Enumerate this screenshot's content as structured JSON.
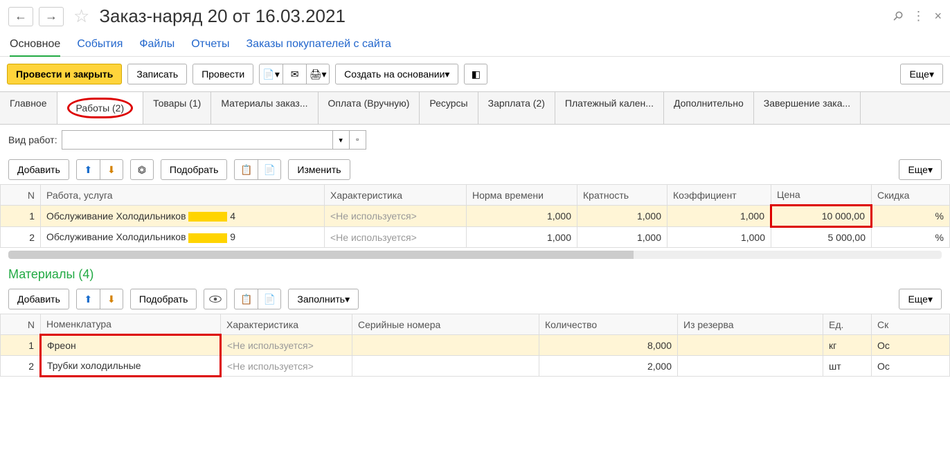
{
  "header": {
    "title": "Заказ-наряд 20 от 16.03.2021"
  },
  "nav": {
    "tabs": [
      "Основное",
      "События",
      "Файлы",
      "Отчеты",
      "Заказы покупателей с сайта"
    ],
    "active": 0
  },
  "toolbar": {
    "post_close": "Провести и закрыть",
    "save": "Записать",
    "post": "Провести",
    "create_based": "Создать на основании",
    "more": "Еще"
  },
  "subtabs": [
    "Главное",
    "Работы (2)",
    "Товары (1)",
    "Материалы заказ...",
    "Оплата (Вручную)",
    "Ресурсы",
    "Зарплата (2)",
    "Платежный кален...",
    "Дополнительно",
    "Завершение зака..."
  ],
  "subtab_active": 1,
  "work_type_label": "Вид работ:",
  "work_toolbar": {
    "add": "Добавить",
    "select": "Подобрать",
    "edit": "Изменить",
    "more": "Еще"
  },
  "works_table": {
    "headers": [
      "N",
      "Работа, услуга",
      "Характеристика",
      "Норма времени",
      "Кратность",
      "Коэффициент",
      "Цена",
      "Скидка"
    ],
    "rows": [
      {
        "n": "1",
        "name_prefix": "Обслуживание Холодильников ",
        "name_suffix": " 4",
        "char": "<Не используется>",
        "norm": "1,000",
        "mult": "1,000",
        "coef": "1,000",
        "price": "10 000,00",
        "disc": "%",
        "selected": true,
        "price_highlight": true
      },
      {
        "n": "2",
        "name_prefix": "Обслуживание Холодильников ",
        "name_suffix": " 9",
        "char": "<Не используется>",
        "norm": "1,000",
        "mult": "1,000",
        "coef": "1,000",
        "price": "5 000,00",
        "disc": "%",
        "selected": false,
        "price_highlight": false
      }
    ]
  },
  "materials_title": "Материалы (4)",
  "materials_toolbar": {
    "add": "Добавить",
    "select": "Подобрать",
    "fill": "Заполнить",
    "more": "Еще"
  },
  "materials_table": {
    "headers": [
      "N",
      "Номенклатура",
      "Характеристика",
      "Серийные номера",
      "Количество",
      "Из резерва",
      "Ед.",
      "Ск"
    ],
    "rows": [
      {
        "n": "1",
        "name": "Фреон",
        "char": "<Не используется>",
        "serial": "",
        "qty": "8,000",
        "reserve": "",
        "unit": "кг",
        "sk": "Ос",
        "selected": true
      },
      {
        "n": "2",
        "name": "Трубки холодильные",
        "char": "<Не используется>",
        "serial": "",
        "qty": "2,000",
        "reserve": "",
        "unit": "шт",
        "sk": "Ос",
        "selected": false
      }
    ]
  }
}
